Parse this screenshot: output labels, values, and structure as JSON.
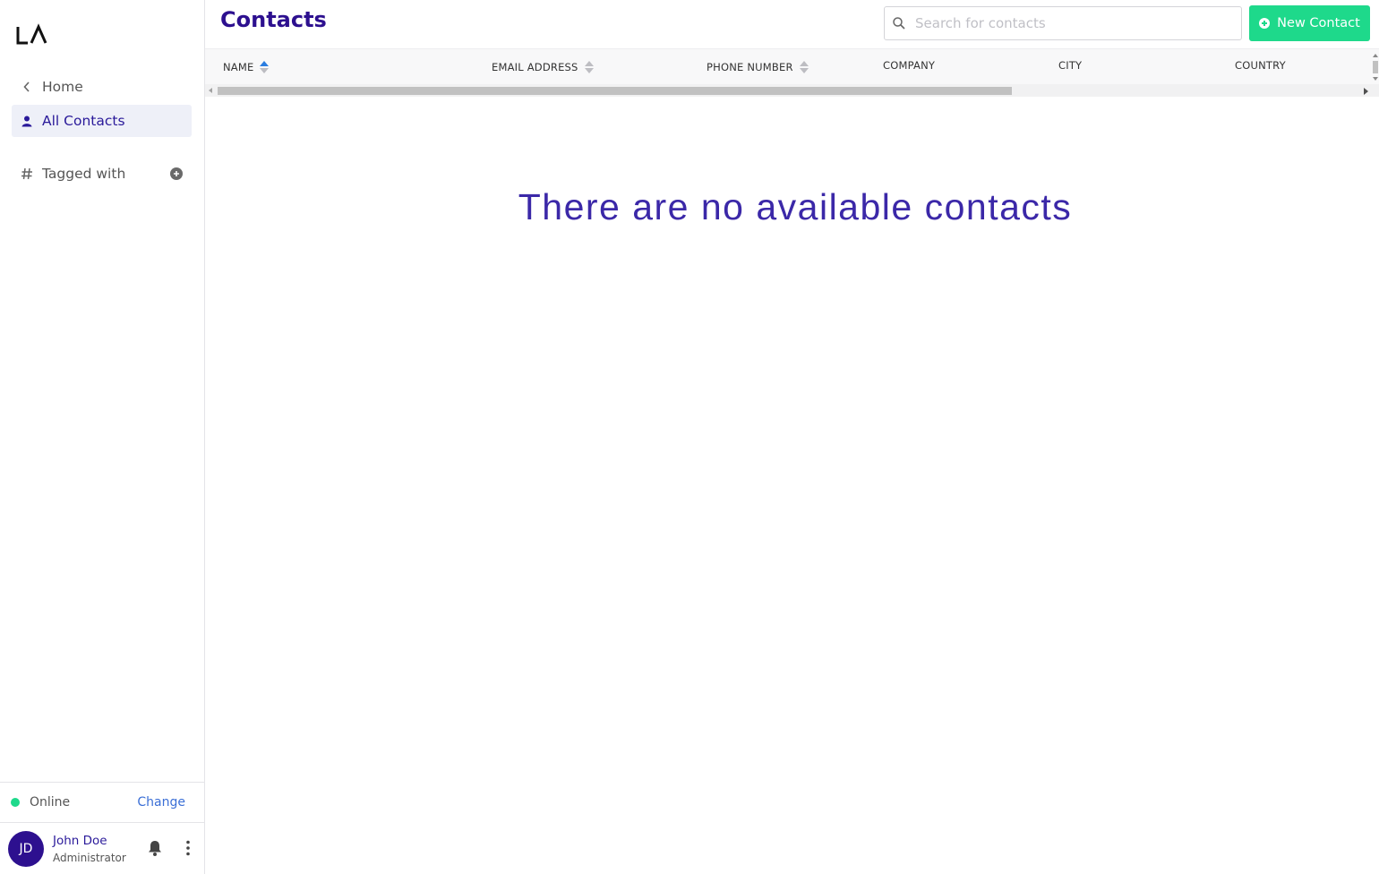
{
  "brand": {
    "logo_text": "LA"
  },
  "sidebar": {
    "home_label": "Home",
    "all_contacts_label": "All Contacts",
    "tagged_label": "Tagged with"
  },
  "status": {
    "label": "Online",
    "change_label": "Change",
    "color": "#1ed98b"
  },
  "user": {
    "initials": "JD",
    "name": "John Doe",
    "role": "Administrator"
  },
  "header": {
    "title": "Contacts",
    "search_placeholder": "Search for contacts",
    "new_button_label": "New Contact"
  },
  "table": {
    "columns": [
      {
        "label": "NAME",
        "sortable": true,
        "sorted": "asc"
      },
      {
        "label": "EMAIL ADDRESS",
        "sortable": true
      },
      {
        "label": "PHONE NUMBER",
        "sortable": true
      },
      {
        "label": "COMPANY",
        "sortable": false
      },
      {
        "label": "CITY",
        "sortable": false
      },
      {
        "label": "COUNTRY",
        "sortable": false
      }
    ],
    "rows": [],
    "empty_message": "There are no available contacts"
  },
  "colors": {
    "primary": "#2d108f",
    "accent": "#1ed98b",
    "link": "#3b6fd6"
  }
}
